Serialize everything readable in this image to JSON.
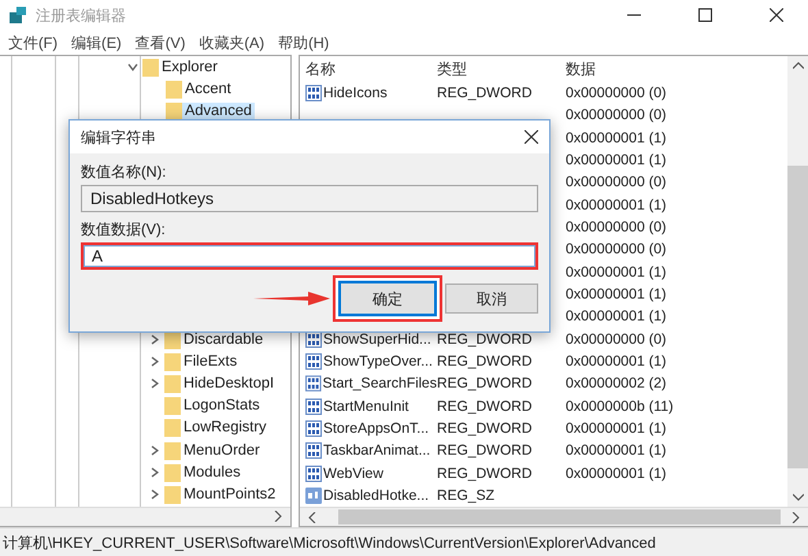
{
  "window": {
    "title": "注册表编辑器"
  },
  "menu": [
    {
      "label": "文件(F)"
    },
    {
      "label": "编辑(E)"
    },
    {
      "label": "查看(V)"
    },
    {
      "label": "收藏夹(A)"
    },
    {
      "label": "帮助(H)"
    }
  ],
  "tree": [
    {
      "label": "Explorer",
      "expandable": true,
      "expanded": true,
      "selected": false,
      "children": [
        {
          "label": "Accent",
          "expandable": false,
          "selected": false
        },
        {
          "label": "Advanced",
          "expandable": false,
          "selected": true
        },
        {
          "label": "Discardable",
          "expandable": true,
          "selected": false
        },
        {
          "label": "FileExts",
          "expandable": true,
          "selected": false
        },
        {
          "label": "HideDesktopI",
          "expandable": true,
          "selected": false
        },
        {
          "label": "LogonStats",
          "expandable": false,
          "selected": false
        },
        {
          "label": "LowRegistry",
          "expandable": false,
          "selected": false
        },
        {
          "label": "MenuOrder",
          "expandable": true,
          "selected": false
        },
        {
          "label": "Modules",
          "expandable": true,
          "selected": false
        },
        {
          "label": "MountPoints2",
          "expandable": true,
          "selected": false
        }
      ]
    }
  ],
  "table": {
    "columns": [
      "名称",
      "类型",
      "数据"
    ],
    "rows": [
      {
        "kind": "dword",
        "name": "HideIcons",
        "type": "REG_DWORD",
        "data": "0x00000000 (0)"
      },
      {
        "data": "0x00000000 (0)"
      },
      {
        "data": "0x00000001 (1)"
      },
      {
        "data": "0x00000001 (1)"
      },
      {
        "data": "0x00000000 (0)"
      },
      {
        "data": "0x00000001 (1)"
      },
      {
        "data": "0x00000000 (0)"
      },
      {
        "data": "0x00000000 (0)"
      },
      {
        "data": "0x00000001 (1)"
      },
      {
        "data": "0x00000001 (1)"
      },
      {
        "data": "0x00000001 (1)"
      },
      {
        "kind": "dword",
        "name": "ShowSuperHid...",
        "type": "REG_DWORD",
        "data": "0x00000000 (0)"
      },
      {
        "kind": "dword",
        "name": "ShowTypeOver...",
        "type": "REG_DWORD",
        "data": "0x00000001 (1)"
      },
      {
        "kind": "dword",
        "name": "Start_SearchFiles",
        "type": "REG_DWORD",
        "data": "0x00000002 (2)"
      },
      {
        "kind": "dword",
        "name": "StartMenuInit",
        "type": "REG_DWORD",
        "data": "0x0000000b (11)"
      },
      {
        "kind": "dword",
        "name": "StoreAppsOnT...",
        "type": "REG_DWORD",
        "data": "0x00000001 (1)"
      },
      {
        "kind": "dword",
        "name": "TaskbarAnimat...",
        "type": "REG_DWORD",
        "data": "0x00000001 (1)"
      },
      {
        "kind": "dword",
        "name": "WebView",
        "type": "REG_DWORD",
        "data": "0x00000001 (1)"
      },
      {
        "kind": "string",
        "name": "DisabledHotke...",
        "type": "REG_SZ"
      }
    ]
  },
  "status_bar": "计算机\\HKEY_CURRENT_USER\\Software\\Microsoft\\Windows\\CurrentVersion\\Explorer\\Advanced",
  "dialog": {
    "title": "编辑字符串",
    "name_label": "数值名称(N):",
    "name_value": "DisabledHotkeys",
    "data_label": "数值数据(V):",
    "data_value": "A",
    "data_highlighted": true,
    "buttons": [
      {
        "label": "确定",
        "default": true,
        "highlighted": true
      },
      {
        "label": "取消",
        "default": false,
        "highlighted": false
      }
    ]
  }
}
